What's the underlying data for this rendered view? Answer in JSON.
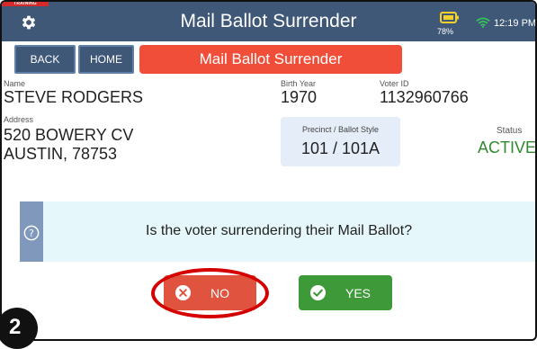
{
  "header": {
    "training_label": "TRAINING",
    "title": "Mail Ballot Surrender",
    "battery_percent": "78%",
    "time": "12:19 PM",
    "colors": {
      "bar": "#3f5878",
      "training": "#d42a2a",
      "battery": "#f2cf2d",
      "wifi": "#34c759"
    }
  },
  "nav": {
    "back_label": "BACK",
    "home_label": "HOME",
    "page_title": "Mail Ballot Surrender"
  },
  "voter": {
    "name_label": "Name",
    "name": "STEVE RODGERS",
    "birth_year_label": "Birth Year",
    "birth_year": "1970",
    "voter_id_label": "Voter ID",
    "voter_id": "1132960766",
    "address_label": "Address",
    "address_line1": "520 BOWERY CV",
    "address_line2": "AUSTIN, 78753",
    "precinct_label": "Precinct / Ballot Style",
    "precinct": "101 / 101A",
    "status_label": "Status",
    "status": "ACTIVE"
  },
  "question": {
    "icon": "help-circle-icon",
    "text": "Is the voter surrendering their Mail Ballot?"
  },
  "actions": {
    "no_label": "NO",
    "yes_label": "YES",
    "no_icon": "x-circle-icon",
    "yes_icon": "check-circle-icon",
    "no_color": "#e0533e",
    "yes_color": "#3e9a39",
    "highlight_color": "#d40000"
  },
  "annotation": {
    "step_number": "2"
  }
}
